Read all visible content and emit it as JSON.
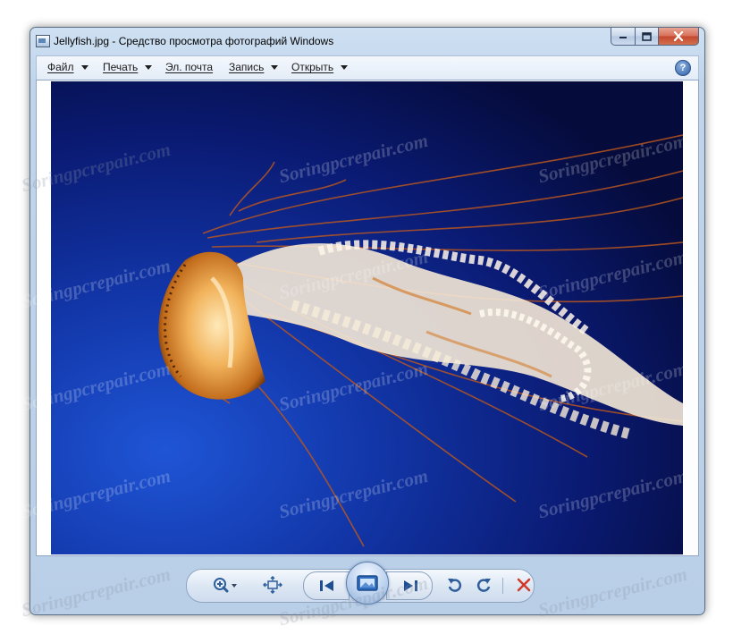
{
  "window": {
    "title": "Jellyfish.jpg - Средство просмотра фотографий Windows"
  },
  "menu": {
    "items": [
      {
        "label": "Файл",
        "has_dropdown": true
      },
      {
        "label": "Печать",
        "has_dropdown": true
      },
      {
        "label": "Эл. почта",
        "has_dropdown": false
      },
      {
        "label": "Запись",
        "has_dropdown": true
      },
      {
        "label": "Открыть",
        "has_dropdown": true
      }
    ],
    "help_label": "?"
  },
  "photo": {
    "subject": "jellyfish"
  },
  "toolbar": {
    "icons": [
      "zoom-icon",
      "fit-to-window-icon",
      "previous-icon",
      "slideshow-icon",
      "next-icon",
      "rotate-counterclockwise-icon",
      "rotate-clockwise-icon",
      "delete-icon"
    ]
  },
  "watermark": {
    "text": "Soringpcrepair.com"
  },
  "colors": {
    "accent": "#3a6fb0",
    "delete": "#d23a2a",
    "photo_background": "#0a1a7a"
  }
}
